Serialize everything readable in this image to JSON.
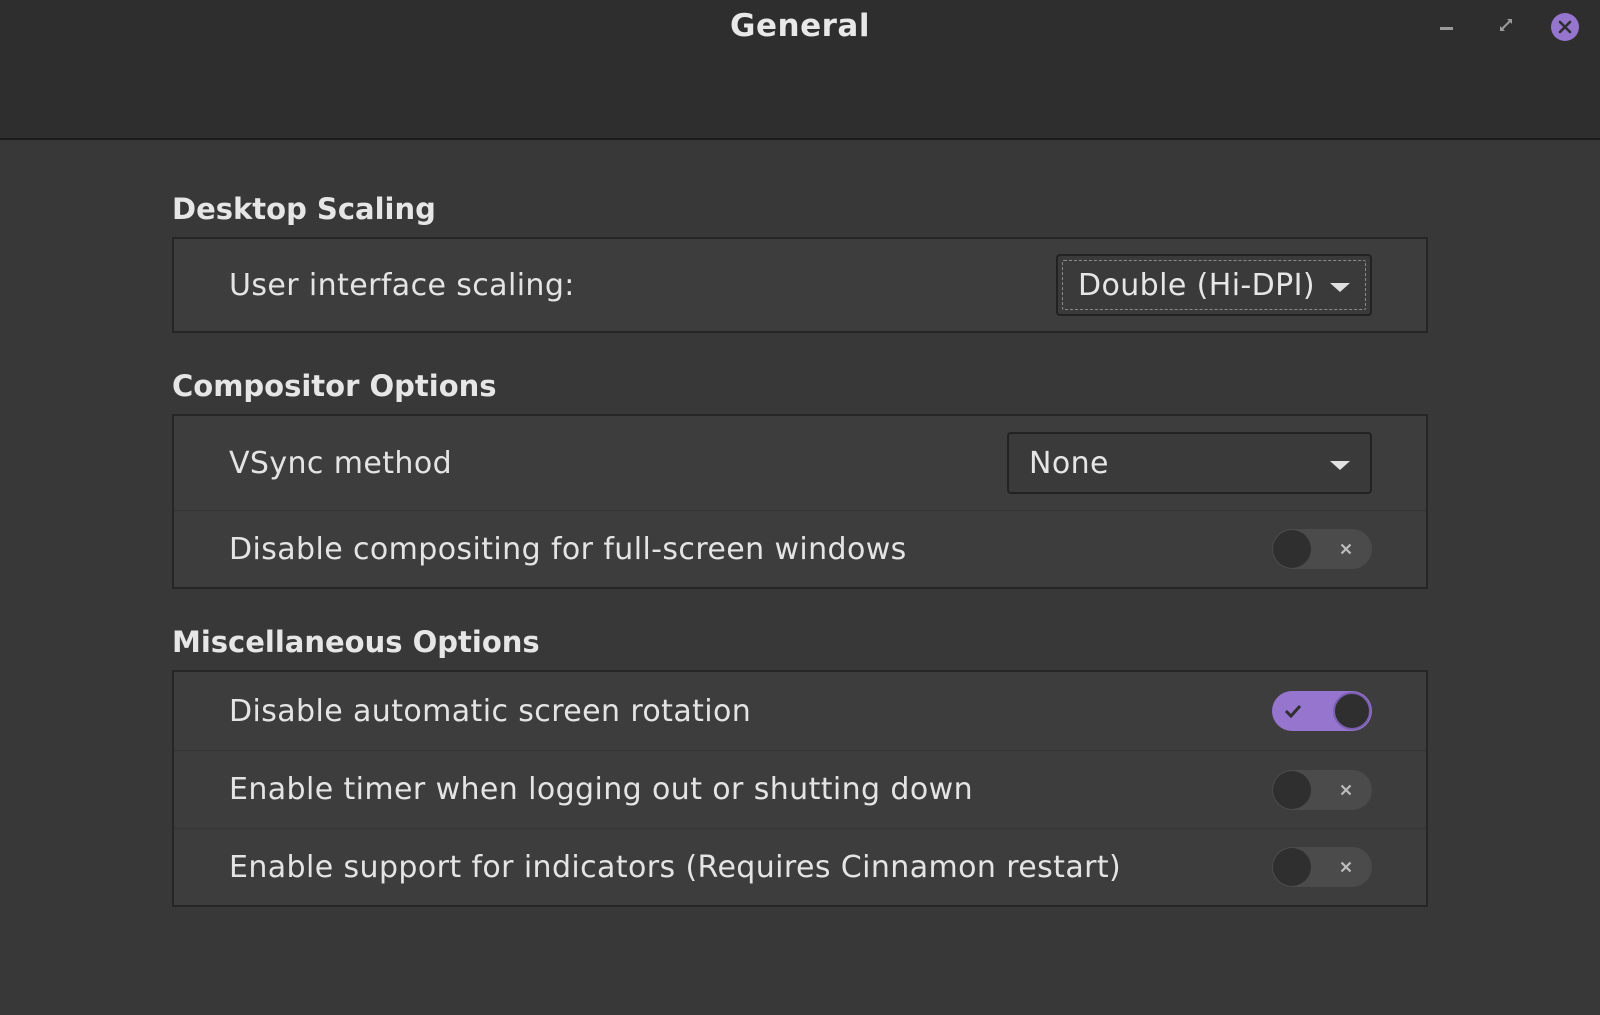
{
  "window": {
    "title": "General",
    "controls": {
      "minimize_icon": "minimize-icon",
      "maximize_icon": "maximize-icon",
      "close_icon": "close-icon"
    }
  },
  "accent_color": "#9575cd",
  "sections": {
    "desktop_scaling": {
      "title": "Desktop Scaling",
      "ui_scaling": {
        "label": "User interface scaling:",
        "value": "Double (Hi-DPI)"
      }
    },
    "compositor": {
      "title": "Compositor Options",
      "vsync": {
        "label": "VSync method",
        "value": "None"
      },
      "disable_compositing": {
        "label": "Disable compositing for full-screen windows",
        "enabled": false
      }
    },
    "misc": {
      "title": "Miscellaneous Options",
      "disable_rotation": {
        "label": "Disable automatic screen rotation",
        "enabled": true
      },
      "logout_timer": {
        "label": "Enable timer when logging out or shutting down",
        "enabled": false
      },
      "indicators": {
        "label": "Enable support for indicators (Requires Cinnamon restart)",
        "enabled": false
      }
    }
  }
}
